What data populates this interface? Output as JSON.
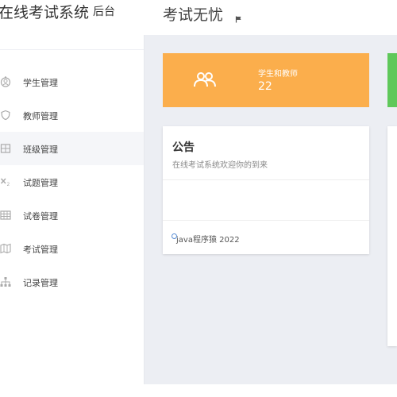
{
  "sidebar": {
    "logo_main": "在线考试系统",
    "logo_sub": "后台",
    "items": [
      {
        "label": "学生管理",
        "icon": "user-icon"
      },
      {
        "label": "教师管理",
        "icon": "shield-icon"
      },
      {
        "label": "班级管理",
        "icon": "grid-icon"
      },
      {
        "label": "试题管理",
        "icon": "formula-icon"
      },
      {
        "label": "试卷管理",
        "icon": "table-icon"
      },
      {
        "label": "考试管理",
        "icon": "map-icon"
      },
      {
        "label": "记录管理",
        "icon": "sitemap-icon"
      }
    ]
  },
  "header": {
    "title": "考试无忧",
    "flag_icon": "flag-icon"
  },
  "stat_card": {
    "label": "学生和教师",
    "value": "22",
    "icon": "users-icon",
    "color": "#fbae4c"
  },
  "notice": {
    "title": "公告",
    "subtitle": "在线考试系统欢迎你的到来",
    "footer": "java程序猿 2022"
  },
  "colors": {
    "accent_orange": "#fbae4c",
    "accent_green": "#5fc85a",
    "background": "#eceef3"
  }
}
